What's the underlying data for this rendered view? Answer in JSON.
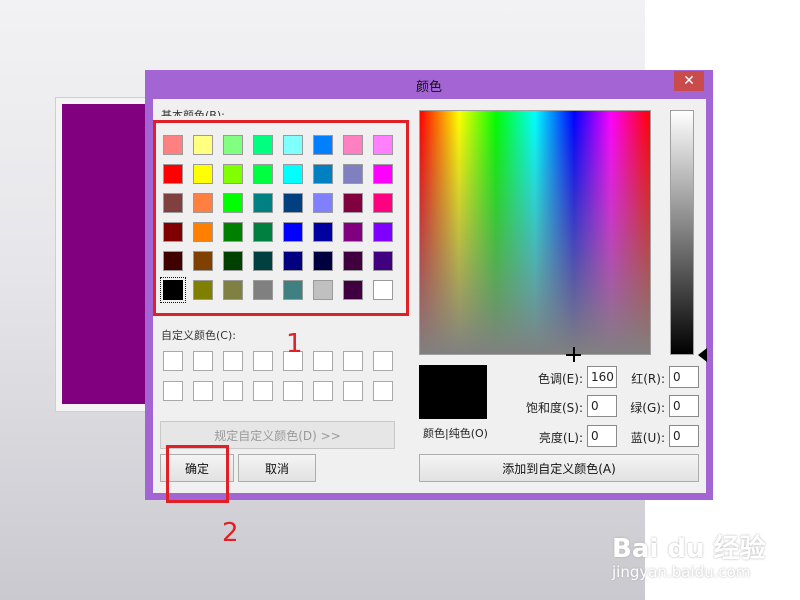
{
  "dialog": {
    "title": "颜色",
    "close_glyph": "✕",
    "basic_colors_label": "基本颜色(B):",
    "custom_colors_label": "自定义颜色(C):",
    "define_custom_label": "规定自定义颜色(D) >>",
    "ok_label": "确定",
    "cancel_label": "取消",
    "add_custom_label": "添加到自定义颜色(A)",
    "solid_label": "颜色|纯色(O)",
    "hue_label": "色调(E):",
    "hue_value": "160",
    "sat_label": "饱和度(S):",
    "sat_value": "0",
    "lum_label": "亮度(L):",
    "lum_value": "0",
    "red_label": "红(R):",
    "red_value": "0",
    "green_label": "绿(G):",
    "green_value": "0",
    "blue_label": "蓝(U):",
    "blue_value": "0"
  },
  "basic_colors": [
    "#ff8080",
    "#ffff80",
    "#80ff80",
    "#00ff80",
    "#80ffff",
    "#0080ff",
    "#ff80c0",
    "#ff80ff",
    "#ff0000",
    "#ffff00",
    "#80ff00",
    "#00ff40",
    "#00ffff",
    "#0080c0",
    "#8080c0",
    "#ff00ff",
    "#804040",
    "#ff8040",
    "#00ff00",
    "#008080",
    "#004080",
    "#8080ff",
    "#800040",
    "#ff0080",
    "#800000",
    "#ff8000",
    "#008000",
    "#008040",
    "#0000ff",
    "#0000a0",
    "#800080",
    "#8000ff",
    "#400000",
    "#804000",
    "#004000",
    "#004040",
    "#000080",
    "#000040",
    "#400040",
    "#400080",
    "#000000",
    "#808000",
    "#808040",
    "#808080",
    "#408080",
    "#c0c0c0",
    "#400040",
    "#ffffff"
  ],
  "selected_basic_index": 40,
  "custom_colors_count": 16,
  "current_color": "#000000",
  "background_swatch_color": "#800080",
  "annotations": {
    "box1": "1",
    "box2": "2"
  },
  "watermark": {
    "brand": "Bai du 经验",
    "url": "jingyan.baidu.com"
  }
}
